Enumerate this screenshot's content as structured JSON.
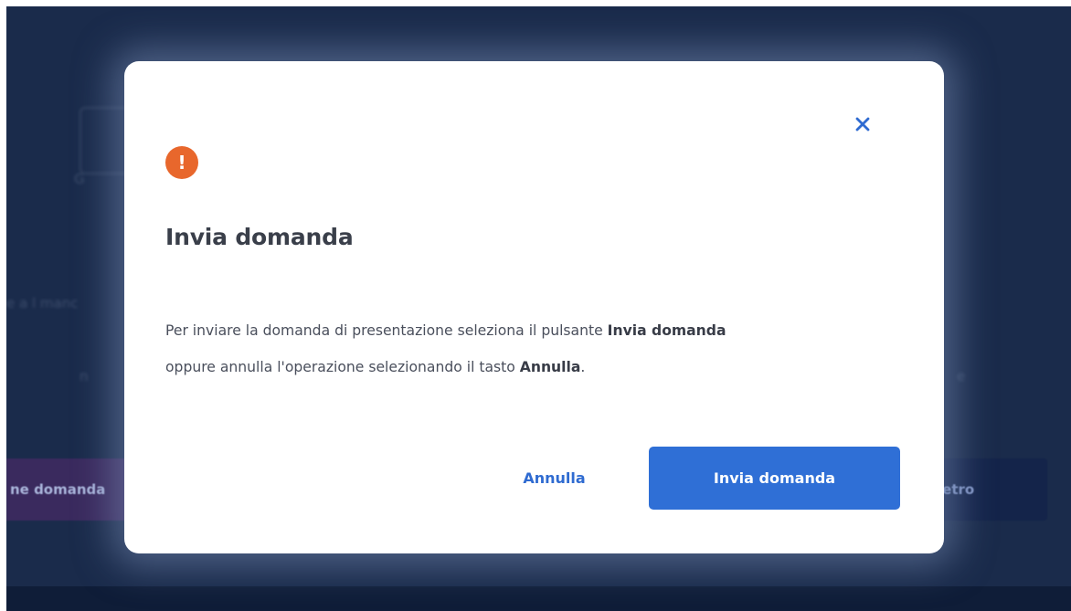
{
  "background": {
    "left_button_label": "ne domanda",
    "right_button_label": "ietro"
  },
  "dialog": {
    "close_icon": "close-icon",
    "alert_icon": "exclamation-icon",
    "alert_glyph": "!",
    "title": "Invia domanda",
    "body": {
      "line1_text": "Per inviare la domanda di presentazione seleziona il pulsante ",
      "line1_bold": "Invia domanda",
      "line2_text": "oppure annulla l'operazione selezionando il tasto ",
      "line2_bold": "Annulla",
      "line2_end": "."
    },
    "cancel_label": "Annulla",
    "submit_label": "Invia domanda"
  },
  "colors": {
    "backdrop": "#1a2b4b",
    "alert": "#e8672c",
    "primary": "#2f6fd6",
    "link": "#2f6bd1"
  }
}
